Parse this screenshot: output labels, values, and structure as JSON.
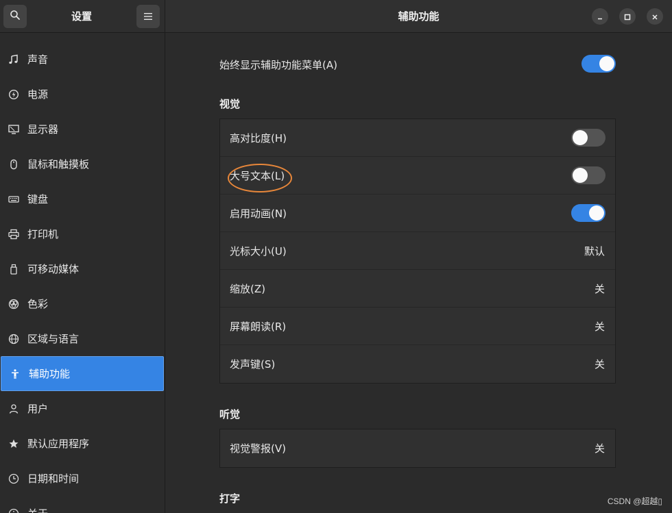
{
  "sidebar": {
    "title": "设置",
    "items": [
      {
        "label": "声音",
        "icon": "music-note-icon"
      },
      {
        "label": "电源",
        "icon": "power-icon"
      },
      {
        "label": "显示器",
        "icon": "display-icon"
      },
      {
        "label": "鼠标和触摸板",
        "icon": "mouse-icon"
      },
      {
        "label": "键盘",
        "icon": "keyboard-icon"
      },
      {
        "label": "打印机",
        "icon": "printer-icon"
      },
      {
        "label": "可移动媒体",
        "icon": "removable-media-icon"
      },
      {
        "label": "色彩",
        "icon": "color-icon"
      },
      {
        "label": "区域与语言",
        "icon": "globe-icon"
      },
      {
        "label": "辅助功能",
        "icon": "accessibility-icon",
        "active": true
      },
      {
        "label": "用户",
        "icon": "users-icon"
      },
      {
        "label": "默认应用程序",
        "icon": "star-icon"
      },
      {
        "label": "日期和时间",
        "icon": "clock-icon"
      },
      {
        "label": "关于",
        "icon": "info-icon"
      }
    ]
  },
  "header": {
    "title": "辅助功能"
  },
  "main": {
    "always_show_menu": {
      "label": "始终显示辅助功能菜单(A)",
      "on": true
    },
    "vision": {
      "title": "视觉",
      "rows": [
        {
          "label": "高对比度(H)",
          "type": "switch",
          "on": false
        },
        {
          "label": "大号文本(L)",
          "type": "switch",
          "on": false
        },
        {
          "label": "启用动画(N)",
          "type": "switch",
          "on": true
        },
        {
          "label": "光标大小(U)",
          "type": "value",
          "value": "默认"
        },
        {
          "label": "缩放(Z)",
          "type": "value",
          "value": "关"
        },
        {
          "label": "屏幕朗读(R)",
          "type": "value",
          "value": "关"
        },
        {
          "label": "发声键(S)",
          "type": "value",
          "value": "关"
        }
      ]
    },
    "hearing": {
      "title": "听觉",
      "rows": [
        {
          "label": "视觉警报(V)",
          "type": "value",
          "value": "关"
        }
      ]
    },
    "typing": {
      "title": "打字"
    }
  },
  "watermark": "CSDN @超越▯",
  "colors": {
    "accent": "#3584e4",
    "annotation": "#e8873a"
  }
}
